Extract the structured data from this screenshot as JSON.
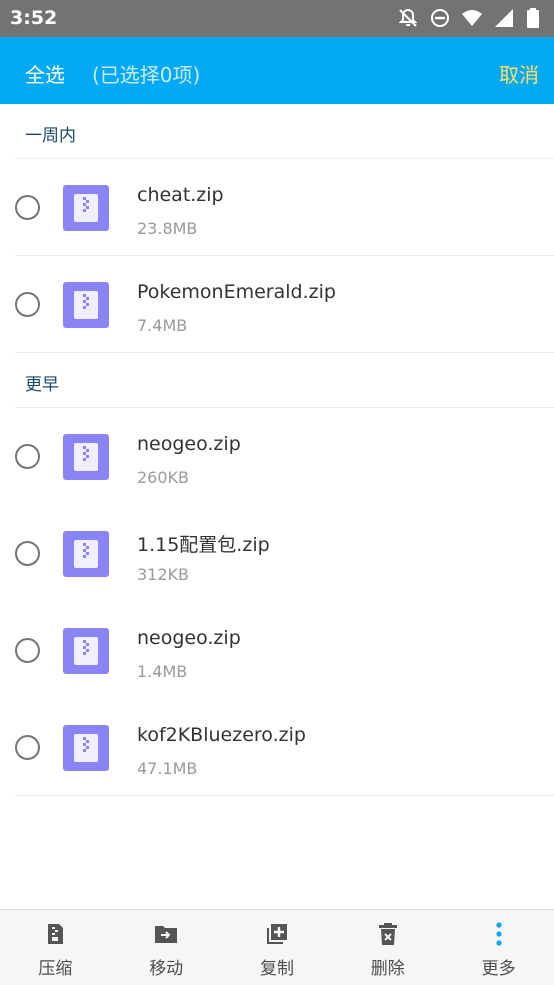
{
  "status_bar": {
    "time": "3:52",
    "icons": [
      "notifications-off-icon",
      "do-not-disturb-icon",
      "wifi-icon",
      "cell-signal-icon",
      "battery-icon"
    ]
  },
  "app_bar": {
    "select_all": "全选",
    "selected_count": "(已选择0项)",
    "cancel": "取消",
    "background_color": "#03a9f4",
    "cancel_color": "#ffe066"
  },
  "sections": [
    {
      "header": "一周内",
      "files": [
        {
          "name": "cheat.zip",
          "size": "23.8MB",
          "selected": false
        },
        {
          "name": "PokemonEmerald.zip",
          "size": "7.4MB",
          "selected": false
        }
      ]
    },
    {
      "header": "更早",
      "files": [
        {
          "name": "neogeo.zip",
          "size": "260KB",
          "selected": false
        },
        {
          "name": "1.15配置包.zip",
          "size": "312KB",
          "selected": false
        },
        {
          "name": "neogeo.zip",
          "size": "1.4MB",
          "selected": false
        },
        {
          "name": "kof2KBluezero.zip",
          "size": "47.1MB",
          "selected": false
        }
      ]
    }
  ],
  "bottom_actions": [
    {
      "label": "压缩",
      "icon": "compress-icon"
    },
    {
      "label": "移动",
      "icon": "move-folder-icon"
    },
    {
      "label": "复制",
      "icon": "copy-icon"
    },
    {
      "label": "删除",
      "icon": "delete-icon"
    },
    {
      "label": "更多",
      "icon": "more-vert-icon",
      "icon_color": "#03a9f4"
    }
  ],
  "file_icon_color": "#8a84f4"
}
